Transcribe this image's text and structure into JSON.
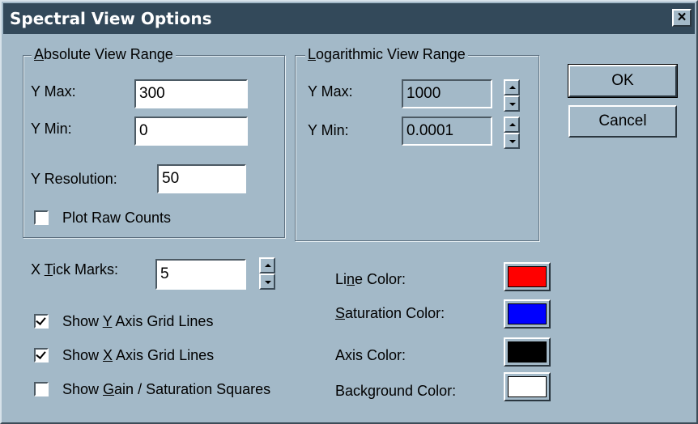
{
  "window": {
    "title": "Spectral View Options",
    "close_label": "×"
  },
  "absolute_range": {
    "legend_pre": "",
    "legend_ul": "A",
    "legend_post": "bsolute View Range",
    "ymax_label": "Y Max:",
    "ymax_value": "300",
    "ymin_label": "Y Min:",
    "ymin_value": "0",
    "yres_label": "Y Resolution:",
    "yres_value": "50",
    "raw_counts_label": "Plot Raw Counts",
    "raw_counts_checked": false
  },
  "log_range": {
    "legend_pre": "",
    "legend_ul": "L",
    "legend_post": "ogarithmic View Range",
    "ymax_label": "Y Max:",
    "ymax_value": "1000",
    "ymin_label": "Y Min:",
    "ymin_value": "0.0001"
  },
  "buttons": {
    "ok": "OK",
    "cancel": "Cancel"
  },
  "ticks": {
    "label_pre": "X ",
    "label_ul": "T",
    "label_post": "ick Marks:",
    "value": "5"
  },
  "checkboxes": [
    {
      "pre": "Show ",
      "ul": "Y",
      "post": " Axis Grid Lines",
      "checked": true
    },
    {
      "pre": "Show ",
      "ul": "X",
      "post": " Axis Grid Lines",
      "checked": true
    },
    {
      "pre": "Show ",
      "ul": "G",
      "post": "ain / Saturation Squares",
      "checked": false
    }
  ],
  "colors": [
    {
      "pre": "Li",
      "ul": "n",
      "post": "e Color:",
      "value": "#ff0000"
    },
    {
      "pre": "",
      "ul": "S",
      "post": "aturation Color:",
      "value": "#0000ff"
    },
    {
      "pre": "Axis Color:",
      "ul": "",
      "post": "",
      "value": "#000000"
    },
    {
      "pre": "Background Color:",
      "ul": "",
      "post": "",
      "value": "#ffffff"
    }
  ]
}
